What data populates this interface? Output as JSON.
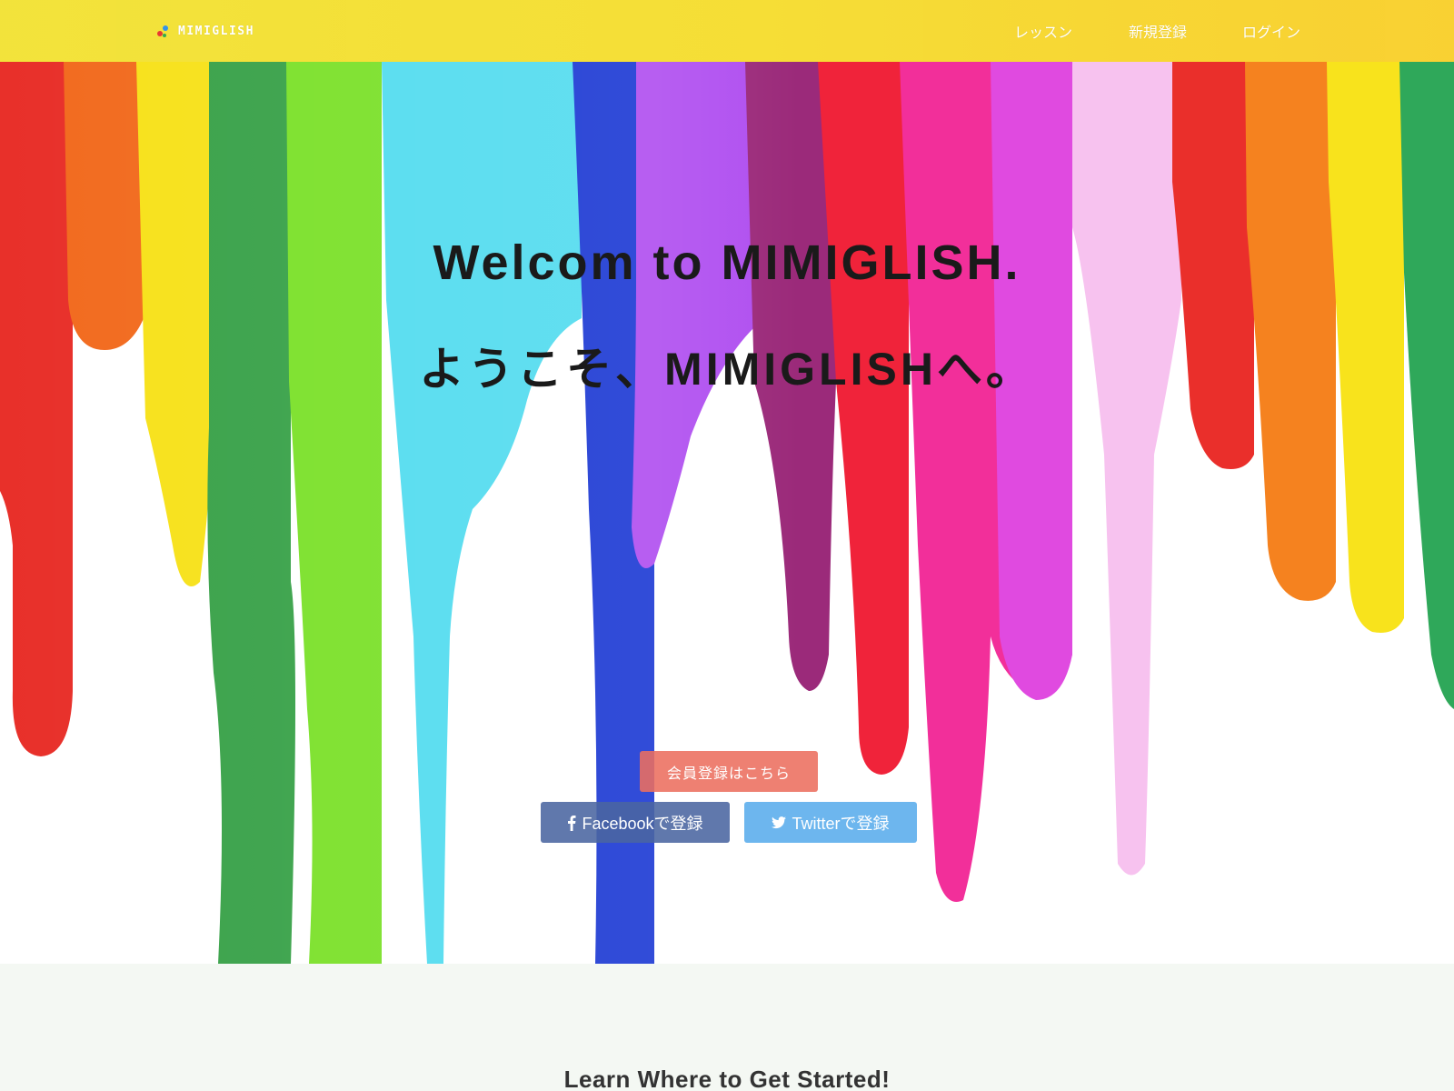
{
  "nav": {
    "brand": "MIMIGLISH",
    "links": [
      "レッスン",
      "新規登録",
      "ログイン"
    ]
  },
  "hero": {
    "headline_en": "Welcom to MIMIGLISH.",
    "headline_jp": "ようこそ、MIMIGLISHへ。",
    "register_button": "会員登録はこちら",
    "facebook_button": "Facebookで登録",
    "twitter_button": "Twitterで登録"
  },
  "section": {
    "title": "Learn Where to Get Started!"
  },
  "colors": {
    "navbar": "#f5dd2e",
    "register_button": "#ec6e5f",
    "facebook_button": "#4a65a1",
    "twitter_button": "#5daeec",
    "section_bg": "#f4f8f3"
  },
  "icons": [
    "paint-drop-icon",
    "facebook-icon",
    "twitter-icon"
  ]
}
